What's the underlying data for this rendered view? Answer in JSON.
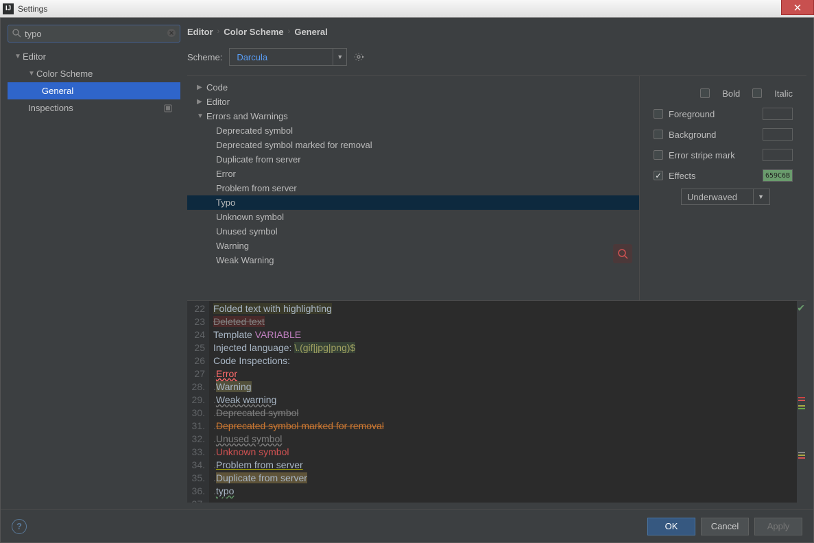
{
  "window": {
    "title": "Settings"
  },
  "search": {
    "value": "typo"
  },
  "tree": {
    "editor": "Editor",
    "colorScheme": "Color Scheme",
    "general": "General",
    "inspections": "Inspections"
  },
  "breadcrumb": {
    "a": "Editor",
    "b": "Color Scheme",
    "c": "General"
  },
  "scheme": {
    "label": "Scheme:",
    "value": "Darcula"
  },
  "categories": {
    "code": "Code",
    "editor": "Editor",
    "errorsAndWarnings": "Errors and Warnings",
    "items": [
      "Deprecated symbol",
      "Deprecated symbol marked for removal",
      "Duplicate from server",
      "Error",
      "Problem from server",
      "Typo",
      "Unknown symbol",
      "Unused symbol",
      "Warning",
      "Weak Warning"
    ]
  },
  "props": {
    "bold": "Bold",
    "italic": "Italic",
    "foreground": "Foreground",
    "background": "Background",
    "errorStripe": "Error stripe mark",
    "effects": "Effects",
    "effectsColor": "659C6B",
    "effectType": "Underwaved"
  },
  "preview": {
    "startLine": 22,
    "lines": [
      "Folded text with highlighting",
      "Deleted text",
      "Template VARIABLE",
      "Injected language: \\.(gif|jpg|png)$",
      "",
      "Code Inspections:",
      " Error",
      " Warning",
      " Weak warning",
      " Deprecated symbol",
      " Deprecated symbol marked for removal",
      " Unused symbol",
      " Unknown symbol",
      " Problem from server",
      " Duplicate from server",
      " typo"
    ]
  },
  "buttons": {
    "ok": "OK",
    "cancel": "Cancel",
    "apply": "Apply"
  }
}
